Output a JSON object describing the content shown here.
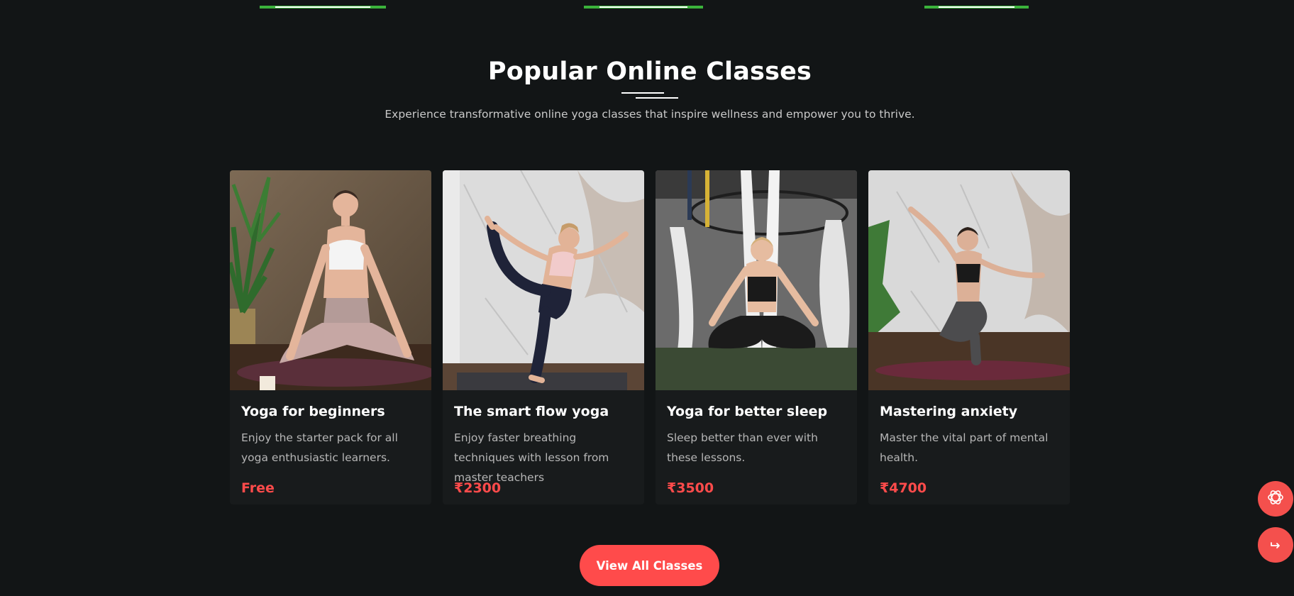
{
  "section": {
    "title": "Popular Online Classes",
    "subtitle": "Experience transformative online yoga classes that inspire wellness and empower you to thrive."
  },
  "classes": [
    {
      "title": "Yoga for beginners",
      "description": "Enjoy the starter pack for all yoga enthusiastic learners.",
      "price": "Free",
      "image": "woman meditating in lotus pose on mat beside plant"
    },
    {
      "title": "The smart flow yoga",
      "description": "Enjoy faster breathing techniques with lesson from master teachers",
      "price": "₹2300",
      "image": "woman in standing dancer yoga pose by marble wall"
    },
    {
      "title": "Yoga for better sleep",
      "description": "Sleep better than ever with these lessons.",
      "price": "₹3500",
      "image": "woman meditating in aerial yoga hammock"
    },
    {
      "title": "Mastering anxiety",
      "description": "Master the vital part of mental health.",
      "price": "₹4700",
      "image": "woman balancing pose with arms raised on mat"
    }
  ],
  "cta": {
    "label": "View All Classes"
  },
  "floating_buttons": {
    "assistant_icon": "openai-assistant-icon",
    "share_icon": "share-arrow-icon"
  },
  "colors": {
    "background": "#121516",
    "accent": "#ff4b4b",
    "progress_green": "#3bb33b"
  }
}
